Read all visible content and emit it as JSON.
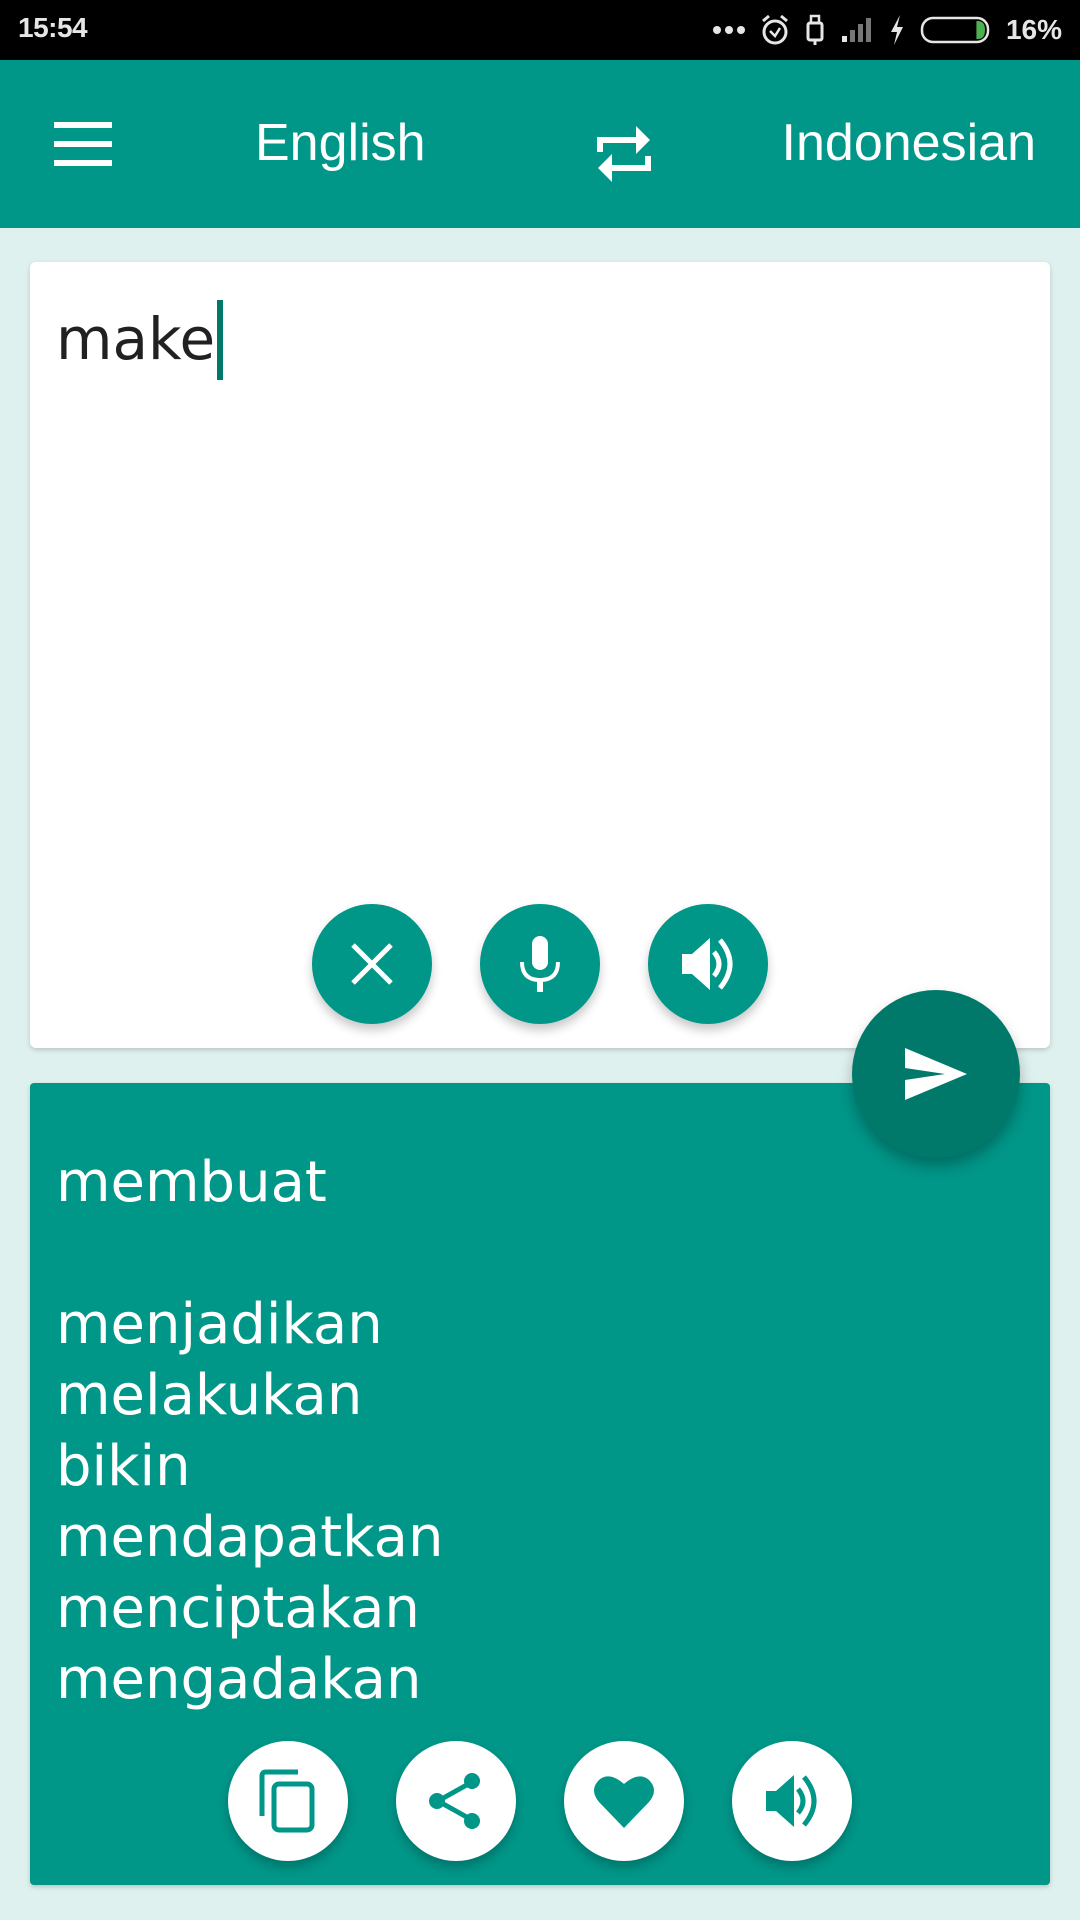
{
  "status_bar": {
    "time": "15:54",
    "battery_percent": "16%",
    "battery_level": 0.16,
    "icons": [
      "more-notifications-icon",
      "alarm-icon",
      "usb-icon",
      "signal-icon",
      "charging-icon",
      "battery-icon"
    ]
  },
  "app_bar": {
    "menu_icon": "hamburger-menu-icon",
    "source_language": "English",
    "swap_icon": "swap-languages-icon",
    "target_language": "Indonesian"
  },
  "input": {
    "value": "make",
    "actions": [
      {
        "name": "clear",
        "icon": "close-icon"
      },
      {
        "name": "voice-input",
        "icon": "microphone-icon"
      },
      {
        "name": "speak-input",
        "icon": "speaker-icon"
      }
    ]
  },
  "translate_button": {
    "icon": "send-icon"
  },
  "output": {
    "primary": "membuat",
    "alternatives": [
      "menjadikan",
      "melakukan",
      "bikin",
      "mendapatkan",
      "menciptakan",
      "mengadakan"
    ],
    "actions": [
      {
        "name": "copy",
        "icon": "copy-icon"
      },
      {
        "name": "share",
        "icon": "share-icon"
      },
      {
        "name": "favorite",
        "icon": "heart-icon"
      },
      {
        "name": "speak-output",
        "icon": "speaker-icon"
      }
    ]
  },
  "colors": {
    "primary": "#009688",
    "primary_dark": "#00796b",
    "background": "#dff1ee",
    "battery_fill": "#4caf50"
  }
}
